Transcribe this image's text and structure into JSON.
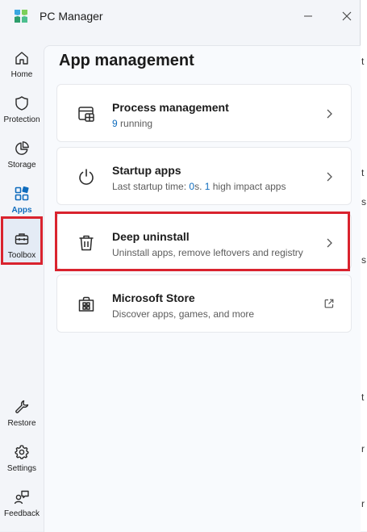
{
  "window": {
    "title": "PC Manager",
    "logo_icon": "pc-manager-logo",
    "minimize_icon": "minimize-icon",
    "close_icon": "close-icon"
  },
  "sidebar": {
    "items": [
      {
        "label": "Home",
        "icon": "home-icon",
        "active": false
      },
      {
        "label": "Protection",
        "icon": "shield-icon",
        "active": false
      },
      {
        "label": "Storage",
        "icon": "pie-chart-icon",
        "active": false
      },
      {
        "label": "Apps",
        "icon": "apps-icon",
        "active": true
      },
      {
        "label": "Toolbox",
        "icon": "toolbox-icon",
        "active": false
      },
      {
        "label": "Restore",
        "icon": "wrench-icon",
        "active": false
      },
      {
        "label": "Settings",
        "icon": "gear-icon",
        "active": false
      },
      {
        "label": "Feedback",
        "icon": "feedback-icon",
        "active": false
      }
    ]
  },
  "main": {
    "title": "App management",
    "cards": [
      {
        "title": "Process management",
        "sub_count": "9",
        "sub_text": " running",
        "icon": "process-window-icon",
        "action_icon": "chevron-right-icon"
      },
      {
        "title": "Startup apps",
        "sub_pre": "Last startup time: ",
        "sub_time": "0",
        "sub_mid": "s. ",
        "sub_count": "1",
        "sub_post": " high impact apps",
        "icon": "power-icon",
        "action_icon": "chevron-right-icon"
      },
      {
        "title": "Deep uninstall",
        "sub_text": "Uninstall apps, remove leftovers and registry",
        "icon": "trash-icon",
        "action_icon": "chevron-right-icon"
      },
      {
        "title": "Microsoft Store",
        "sub_text": "Discover apps, games, and more",
        "icon": "store-icon",
        "action_icon": "open-external-icon"
      }
    ]
  },
  "colors": {
    "accent": "#0f6cbd",
    "highlight_box": "#d9232e",
    "content_bg": "#f8fafd",
    "card_bg": "#ffffff"
  },
  "background_window": {
    "glyphs": [
      "t",
      "t",
      "s",
      "s",
      "t",
      "r",
      "r"
    ]
  }
}
